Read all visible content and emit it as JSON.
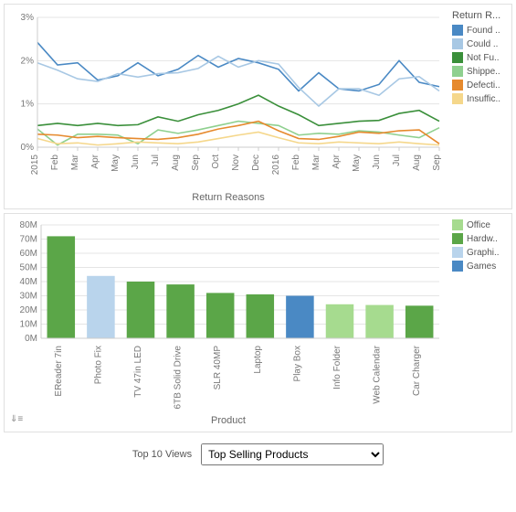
{
  "chart_data": [
    {
      "type": "line",
      "title": "",
      "xlabel": "Return Reasons",
      "ylabel": "",
      "ylim": [
        0,
        3
      ],
      "y_format": "percent",
      "legend_title": "Return R...",
      "categories": [
        "2015",
        "Feb",
        "Mar",
        "Apr",
        "May",
        "Jun",
        "Jul",
        "Aug",
        "Sep",
        "Oct",
        "Nov",
        "Dec",
        "2016",
        "Feb",
        "Mar",
        "Apr",
        "May",
        "Jun",
        "Jul",
        "Aug",
        "Sep"
      ],
      "series": [
        {
          "name": "Found ..",
          "color": "#4a89c4",
          "values": [
            2.42,
            1.9,
            1.95,
            1.55,
            1.65,
            1.95,
            1.65,
            1.8,
            2.12,
            1.85,
            2.05,
            1.95,
            1.8,
            1.3,
            1.72,
            1.35,
            1.3,
            1.45,
            2.0,
            1.5,
            1.4
          ]
        },
        {
          "name": "Could ..",
          "color": "#a8c8e4",
          "values": [
            1.95,
            1.78,
            1.58,
            1.52,
            1.7,
            1.62,
            1.7,
            1.72,
            1.82,
            2.1,
            1.85,
            2.0,
            1.92,
            1.38,
            0.95,
            1.35,
            1.35,
            1.2,
            1.58,
            1.63,
            1.3
          ]
        },
        {
          "name": "Not Fu..",
          "color": "#3a8f3a",
          "values": [
            0.5,
            0.55,
            0.5,
            0.55,
            0.5,
            0.52,
            0.7,
            0.6,
            0.75,
            0.85,
            1.0,
            1.2,
            0.95,
            0.75,
            0.5,
            0.55,
            0.6,
            0.62,
            0.78,
            0.85,
            0.6
          ]
        },
        {
          "name": "Shippe..",
          "color": "#8fd08f",
          "values": [
            0.42,
            0.05,
            0.3,
            0.3,
            0.28,
            0.08,
            0.4,
            0.32,
            0.4,
            0.5,
            0.6,
            0.55,
            0.5,
            0.28,
            0.32,
            0.3,
            0.38,
            0.35,
            0.28,
            0.22,
            0.45
          ]
        },
        {
          "name": "Defecti..",
          "color": "#e68a2e",
          "values": [
            0.3,
            0.28,
            0.22,
            0.25,
            0.22,
            0.2,
            0.18,
            0.22,
            0.3,
            0.42,
            0.5,
            0.6,
            0.38,
            0.2,
            0.18,
            0.25,
            0.35,
            0.32,
            0.38,
            0.4,
            0.08
          ]
        },
        {
          "name": "Insuffic..",
          "color": "#f5d78b",
          "values": [
            0.2,
            0.08,
            0.1,
            0.05,
            0.08,
            0.12,
            0.1,
            0.08,
            0.12,
            0.2,
            0.28,
            0.35,
            0.22,
            0.1,
            0.08,
            0.12,
            0.1,
            0.08,
            0.12,
            0.08,
            0.05
          ]
        }
      ]
    },
    {
      "type": "bar",
      "title": "",
      "xlabel": "Product",
      "ylabel": "",
      "ylim": [
        0,
        80
      ],
      "y_suffix": "M",
      "legend_title": "",
      "categories": [
        "EReader 7in",
        "Photo Fix",
        "TV 47in LED",
        "6TB Solid Drive",
        "SLR 40MP",
        "Laptop",
        "Play Box",
        "Info Folder",
        "Web Calendar",
        "Car Charger"
      ],
      "series_groups": [
        "Hardw..",
        "Graphi..",
        "Hardw..",
        "Hardw..",
        "Hardw..",
        "Hardw..",
        "Games",
        "Office",
        "Office",
        "Hardw.."
      ],
      "values": [
        72,
        44,
        40,
        38,
        32,
        31,
        30,
        24,
        23.5,
        23
      ],
      "legend": [
        {
          "name": "Office",
          "color": "#a6db8f"
        },
        {
          "name": "Hardw..",
          "color": "#5ba648"
        },
        {
          "name": "Graphi..",
          "color": "#b9d4ec"
        },
        {
          "name": "Games",
          "color": "#4a89c4"
        }
      ]
    }
  ],
  "footer": {
    "label": "Top 10 Views",
    "select_value": "Top Selling Products"
  },
  "icons": {
    "download": "⇓≡"
  }
}
